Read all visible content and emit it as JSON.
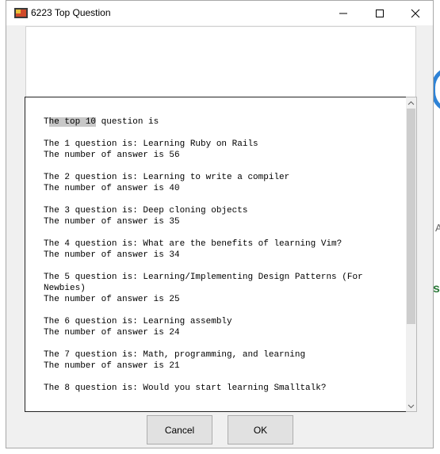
{
  "window": {
    "title": "6223 Top Question"
  },
  "content": {
    "heading_prefix": "T",
    "heading_highlight": "he top 10",
    "heading_suffix": " question is",
    "entries": [
      {
        "question": "The 1 question is: Learning Ruby on Rails",
        "answers": "The number of answer is 56"
      },
      {
        "question": "The 2 question is: Learning to write a compiler",
        "answers": "The number of answer is 40"
      },
      {
        "question": "The 3 question is: Deep cloning objects",
        "answers": "The number of answer is 35"
      },
      {
        "question": "The 4 question is: What are the benefits of learning Vim?",
        "answers": "The number of answer is 34"
      },
      {
        "question": "The 5 question is: Learning/Implementing Design Patterns (For Newbies)",
        "answers": "The number of answer is 25"
      },
      {
        "question": "The 6 question is: Learning assembly",
        "answers": "The number of answer is 24"
      },
      {
        "question": "The 7 question is: Math, programming, and learning",
        "answers": "The number of answer is 21"
      },
      {
        "question": "The 8 question is: Would you start learning Smalltalk?",
        "answers": ""
      }
    ]
  },
  "buttons": {
    "cancel": "Cancel",
    "ok": "OK"
  },
  "colors": {
    "accent_arc": "#2f83d6",
    "window_bg": "#f0f0f0",
    "selection": "#c8c8c8"
  }
}
